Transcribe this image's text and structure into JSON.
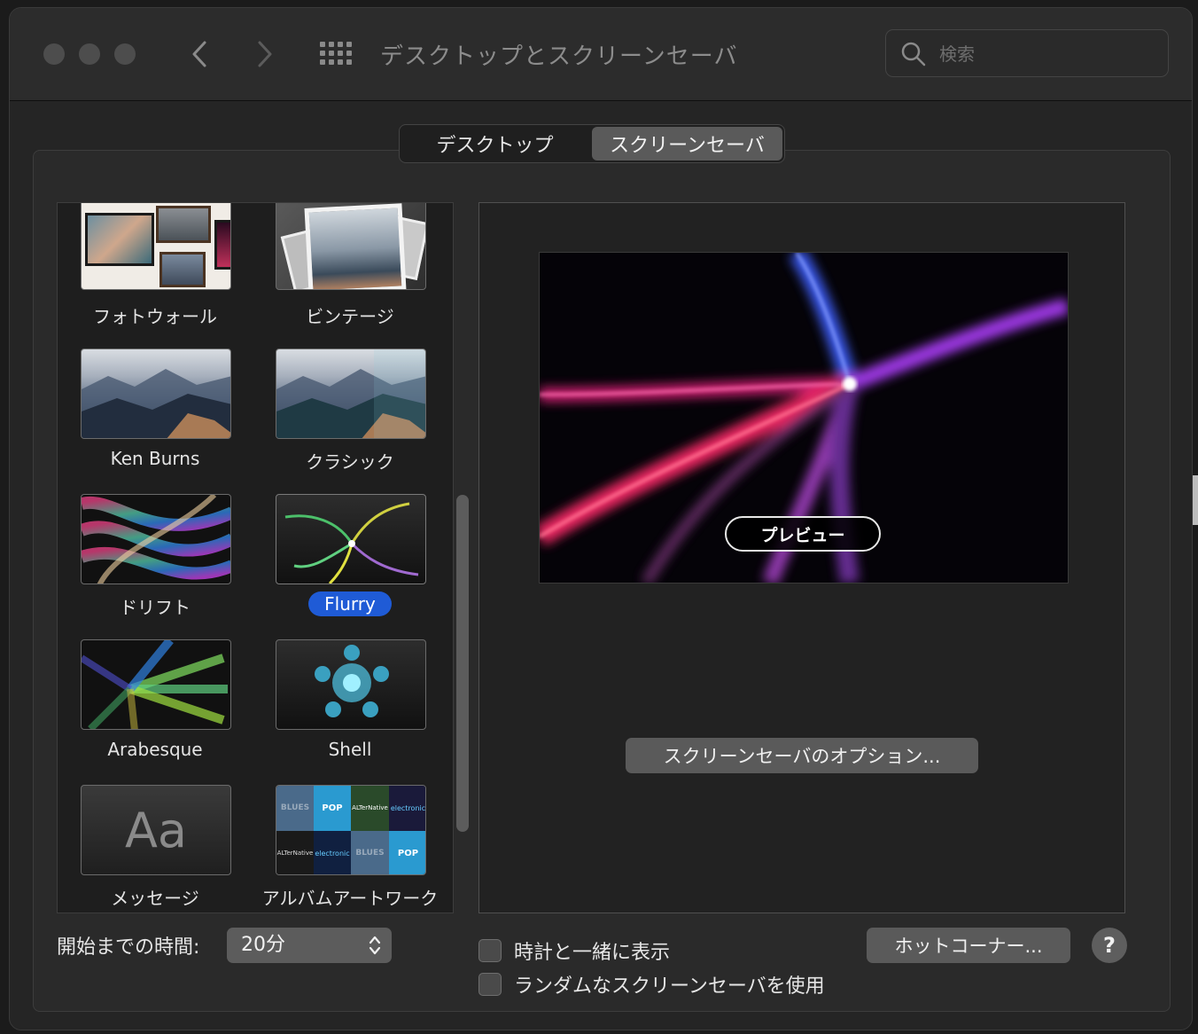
{
  "window": {
    "title": "デスクトップとスクリーンセーバ",
    "search_placeholder": "検索"
  },
  "tabs": [
    {
      "label": "デスクトップ",
      "active": false
    },
    {
      "label": "スクリーンセーバ",
      "active": true
    }
  ],
  "savers": [
    {
      "label": "フォトウォール"
    },
    {
      "label": "ビンテージ"
    },
    {
      "label": "Ken Burns"
    },
    {
      "label": "クラシック"
    },
    {
      "label": "ドリフト"
    },
    {
      "label": "Flurry",
      "selected": true
    },
    {
      "label": "Arabesque"
    },
    {
      "label": "Shell"
    },
    {
      "label": "メッセージ",
      "thumb_text": "Aa"
    },
    {
      "label": "アルバムアートワーク",
      "thumb_text": [
        "BLUES",
        "POP",
        "ALTerNative",
        "electronic",
        "BLUES",
        "POP",
        "ALTerNative",
        "electronic"
      ]
    }
  ],
  "preview": {
    "button_label": "プレビュー"
  },
  "options_button": "スクリーンセーバのオプション...",
  "start": {
    "label": "開始までの時間:",
    "value": "20分"
  },
  "checkboxes": [
    {
      "label": "時計と一緒に表示",
      "checked": false
    },
    {
      "label": "ランダムなスクリーンセーバを使用",
      "checked": false
    }
  ],
  "hot_corners_button": "ホットコーナー...",
  "help_button": "?",
  "colors": {
    "selection": "#1f5bd6",
    "window_bg": "#252525",
    "titlebar_bg": "#2c2c2c"
  }
}
